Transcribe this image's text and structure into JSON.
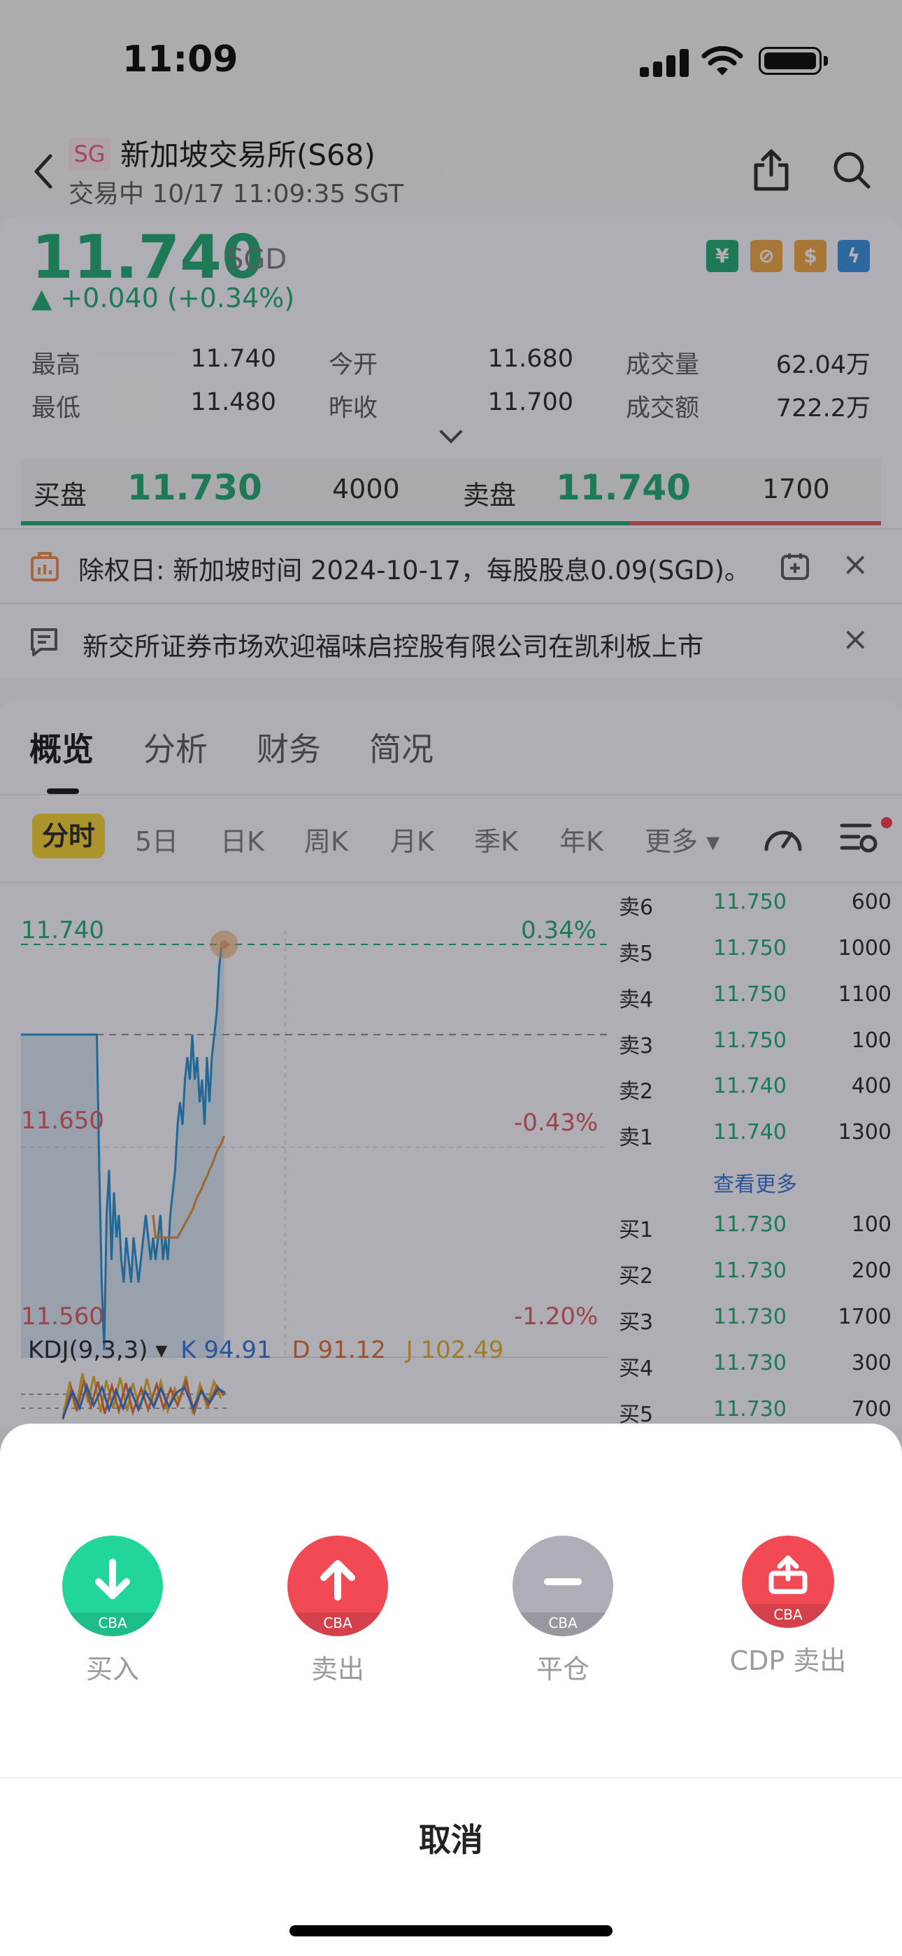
{
  "status_bar": {
    "time": "11:09"
  },
  "header": {
    "market_badge": "SG",
    "title": "新加坡交易所(S68)",
    "status": "交易中 10/17 11:09:35 SGT"
  },
  "quote": {
    "price": "11.740",
    "currency": "SGD",
    "change": "▲ +0.040 (+0.34%)",
    "stats": [
      {
        "label": "最高",
        "value": "11.740"
      },
      {
        "label": "今开",
        "value": "11.680"
      },
      {
        "label": "成交量",
        "value": "62.04万"
      },
      {
        "label": "最低",
        "value": "11.480"
      },
      {
        "label": "昨收",
        "value": "11.700"
      },
      {
        "label": "成交额",
        "value": "722.2万"
      }
    ]
  },
  "order_book_top": {
    "bid_label": "买盘",
    "bid_price": "11.730",
    "bid_qty": "4000",
    "ask_label": "卖盘",
    "ask_price": "11.740",
    "ask_qty": "1700"
  },
  "notices": [
    {
      "text": "除权日: 新加坡时间 2024-10-17，每股股息0.09(SGD)。"
    },
    {
      "text": "新交所证券市场欢迎福味启控股有限公司在凯利板上市"
    }
  ],
  "tabs": [
    "概览",
    "分析",
    "财务",
    "简况"
  ],
  "periods": [
    "分时",
    "5日",
    "日K",
    "周K",
    "月K",
    "季K",
    "年K",
    "更多 ▾"
  ],
  "chart": {
    "high_label": "11.740",
    "high_pct": "0.34%",
    "mid_label": "11.650",
    "mid_pct": "-0.43%",
    "low_label": "11.560",
    "low_pct": "-1.20%",
    "kdj_title": "KDJ(9,3,3) ▾",
    "k": "K 94.91",
    "d": "D 91.12",
    "j": "J 102.49"
  },
  "chart_data": {
    "type": "line",
    "ylim": [
      11.56,
      11.74
    ],
    "series": [
      {
        "values": [
          11.7,
          11.7,
          11.7,
          11.7,
          11.7,
          11.7,
          11.7,
          11.7,
          11.7,
          11.7,
          11.7,
          11.7,
          11.7,
          11.7,
          11.7,
          11.7,
          11.7,
          11.7,
          11.7,
          11.7,
          11.7,
          11.7,
          11.7,
          11.7,
          11.7,
          11.7,
          11.7,
          11.7,
          11.7,
          11.7,
          11.7,
          11.7,
          11.64,
          11.59,
          11.56,
          11.62,
          11.64,
          11.6,
          11.63,
          11.61,
          11.62,
          11.6,
          11.59,
          11.61,
          11.6,
          11.59,
          11.61,
          11.6,
          11.59,
          11.6,
          11.61,
          11.62,
          11.61,
          11.6,
          11.61,
          11.6,
          11.61,
          11.62,
          11.6,
          11.61,
          11.6,
          11.62,
          11.63,
          11.64,
          11.66,
          11.67,
          11.66,
          11.68,
          11.69,
          11.68,
          11.7,
          11.68,
          11.69,
          11.67,
          11.68,
          11.66,
          11.69,
          11.67,
          11.69,
          11.7,
          11.71,
          11.73,
          11.74,
          11.74
        ]
      },
      {
        "values": [
          11.62,
          11.61,
          11.61,
          11.61,
          11.61,
          11.61,
          11.61,
          11.61,
          11.61,
          11.61,
          11.61,
          11.612,
          11.614,
          11.616,
          11.618,
          11.62,
          11.622,
          11.625,
          11.628,
          11.63,
          11.632,
          11.635,
          11.637,
          11.64,
          11.642,
          11.645,
          11.648,
          11.65,
          11.652,
          11.655
        ]
      }
    ]
  },
  "order_book": {
    "asks": [
      {
        "side": "卖6",
        "price": "11.750",
        "qty": "600"
      },
      {
        "side": "卖5",
        "price": "11.750",
        "qty": "1000"
      },
      {
        "side": "卖4",
        "price": "11.750",
        "qty": "1100"
      },
      {
        "side": "卖3",
        "price": "11.750",
        "qty": "100"
      },
      {
        "side": "卖2",
        "price": "11.740",
        "qty": "400"
      },
      {
        "side": "卖1",
        "price": "11.740",
        "qty": "1300"
      }
    ],
    "see_more": "查看更多",
    "bids": [
      {
        "side": "买1",
        "price": "11.730",
        "qty": "100"
      },
      {
        "side": "买2",
        "price": "11.730",
        "qty": "200"
      },
      {
        "side": "买3",
        "price": "11.730",
        "qty": "1700"
      },
      {
        "side": "买4",
        "price": "11.730",
        "qty": "300"
      },
      {
        "side": "买5",
        "price": "11.730",
        "qty": "700"
      }
    ]
  },
  "sheet": {
    "actions": [
      {
        "label": "买入",
        "tag": "CBA",
        "color": "#22d69b",
        "icon": "arrow-down-icon"
      },
      {
        "label": "卖出",
        "tag": "CBA",
        "color": "#f24a55",
        "icon": "arrow-up-icon"
      },
      {
        "label": "平仓",
        "tag": "CBA",
        "color": "#aeaeb8",
        "icon": "minus-icon"
      },
      {
        "label": "CDP 卖出",
        "tag": "CBA",
        "color": "#f24a55",
        "icon": "export-icon"
      }
    ],
    "cancel": "取消"
  }
}
